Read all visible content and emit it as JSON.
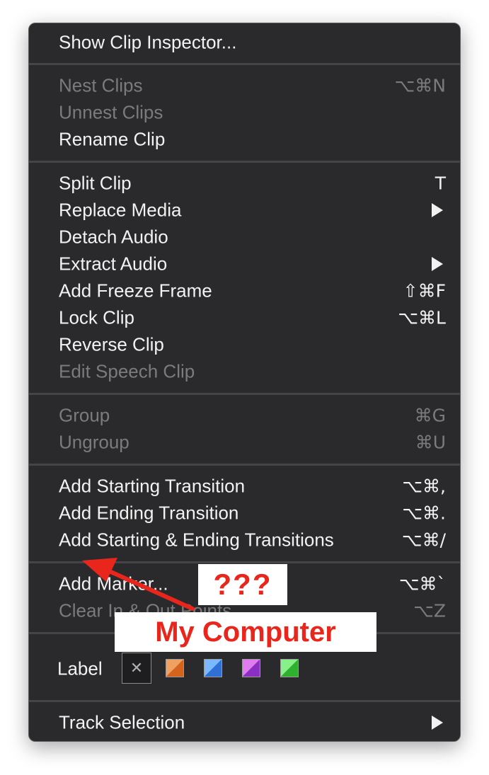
{
  "menu": {
    "items": [
      {
        "label": "Show Clip Inspector...",
        "shortcut": "",
        "enabled": true,
        "submenu": false
      },
      {
        "label": "Nest Clips",
        "shortcut": "⌥⌘N",
        "enabled": false,
        "submenu": false
      },
      {
        "label": "Unnest Clips",
        "shortcut": "",
        "enabled": false,
        "submenu": false
      },
      {
        "label": "Rename Clip",
        "shortcut": "",
        "enabled": true,
        "submenu": false
      },
      {
        "label": "Split Clip",
        "shortcut": "T",
        "enabled": true,
        "submenu": false
      },
      {
        "label": "Replace Media",
        "shortcut": "",
        "enabled": true,
        "submenu": true
      },
      {
        "label": "Detach Audio",
        "shortcut": "",
        "enabled": true,
        "submenu": false
      },
      {
        "label": "Extract Audio",
        "shortcut": "",
        "enabled": true,
        "submenu": true
      },
      {
        "label": "Add Freeze Frame",
        "shortcut": "⇧⌘F",
        "enabled": true,
        "submenu": false
      },
      {
        "label": "Lock Clip",
        "shortcut": "⌥⌘L",
        "enabled": true,
        "submenu": false
      },
      {
        "label": "Reverse Clip",
        "shortcut": "",
        "enabled": true,
        "submenu": false
      },
      {
        "label": "Edit Speech Clip",
        "shortcut": "",
        "enabled": false,
        "submenu": false
      },
      {
        "label": "Group",
        "shortcut": "⌘G",
        "enabled": false,
        "submenu": false
      },
      {
        "label": "Ungroup",
        "shortcut": "⌘U",
        "enabled": false,
        "submenu": false
      },
      {
        "label": "Add Starting Transition",
        "shortcut": "⌥⌘,",
        "enabled": true,
        "submenu": false
      },
      {
        "label": "Add Ending Transition",
        "shortcut": "⌥⌘.",
        "enabled": true,
        "submenu": false
      },
      {
        "label": "Add Starting & Ending Transitions",
        "shortcut": "⌥⌘/",
        "enabled": true,
        "submenu": false
      },
      {
        "label": "Add Marker...",
        "shortcut": "⌥⌘`",
        "enabled": true,
        "submenu": false
      },
      {
        "label": "Clear In & Out Points",
        "shortcut": "⌥Z",
        "enabled": false,
        "submenu": false
      },
      {
        "label": "Track Selection",
        "shortcut": "",
        "enabled": true,
        "submenu": true
      }
    ],
    "label_row": {
      "title": "Label",
      "swatches": [
        {
          "name": "none",
          "color_a": "#1e1e20",
          "color_b": "#1e1e20"
        },
        {
          "name": "orange",
          "color_a": "#f0a060",
          "color_b": "#d2641e"
        },
        {
          "name": "blue",
          "color_a": "#7ab8ff",
          "color_b": "#2f6fd6"
        },
        {
          "name": "purple",
          "color_a": "#e07cf0",
          "color_b": "#8a2fc2"
        },
        {
          "name": "green",
          "color_a": "#88f088",
          "color_b": "#2fb02f"
        }
      ]
    }
  },
  "annotations": {
    "question": "???",
    "caption": "My Computer",
    "color": "#e8261c"
  }
}
